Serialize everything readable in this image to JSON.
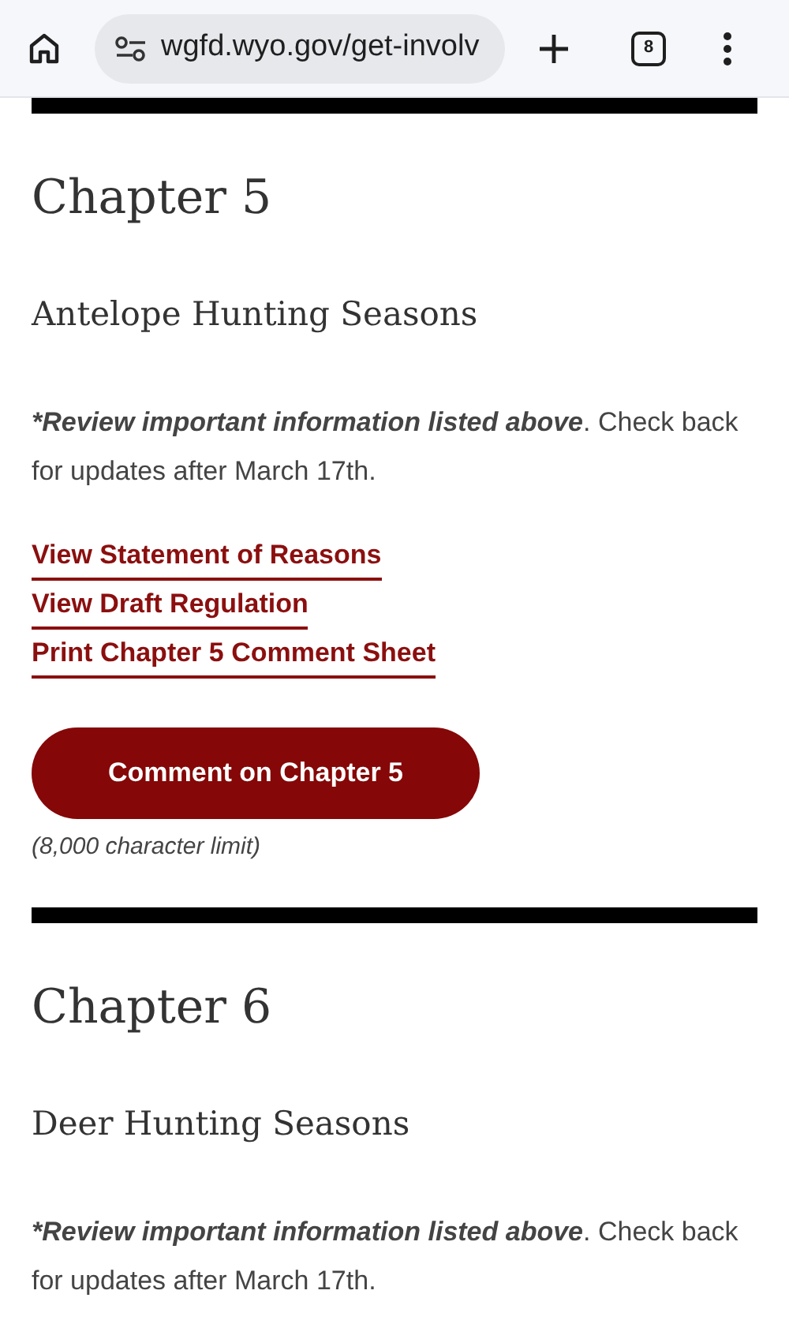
{
  "browser": {
    "url": "wgfd.wyo.gov/get-involv",
    "tab_count": "8"
  },
  "sections": [
    {
      "title": "Chapter 5",
      "subtitle": "Antelope Hunting Seasons",
      "note_emphasis": "*Review important information listed above",
      "note_rest": ". Check back for updates after March 17th.",
      "links": [
        "View Statement of Reasons",
        "View Draft Regulation",
        "Print Chapter 5 Comment Sheet"
      ],
      "button": "Comment on Chapter 5",
      "limit": "(8,000 character limit)"
    },
    {
      "title": "Chapter 6",
      "subtitle": "Deer Hunting Seasons",
      "note_emphasis": "*Review important information listed above",
      "note_rest": ". Check back for updates after March 17th."
    }
  ]
}
